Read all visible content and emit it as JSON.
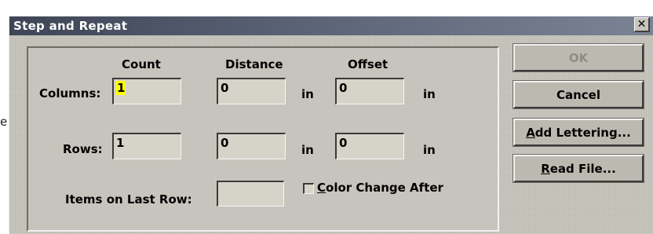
{
  "background_hint": "e",
  "dialog": {
    "title": "Step and Repeat",
    "close_glyph": "✕"
  },
  "headers": {
    "count": "Count",
    "distance": "Distance",
    "offset": "Offset"
  },
  "rows": {
    "columns_label": "Columns:",
    "rows_label": "Rows:"
  },
  "units": "in",
  "fields": {
    "columns_count": "1",
    "columns_distance": "0",
    "columns_offset": "0",
    "rows_count": "1",
    "rows_distance": "0",
    "rows_offset": "0",
    "items_on_last_row": ""
  },
  "items_on_last_row_label": "Items on Last Row:",
  "color_change": {
    "hotkey": "C",
    "rest": "olor Change After",
    "checked": false
  },
  "buttons": {
    "ok": "OK",
    "cancel": "Cancel",
    "add_lettering_hotkey": "A",
    "add_lettering_rest": "dd Lettering...",
    "read_file_hotkey": "R",
    "read_file_rest": "ead File..."
  }
}
